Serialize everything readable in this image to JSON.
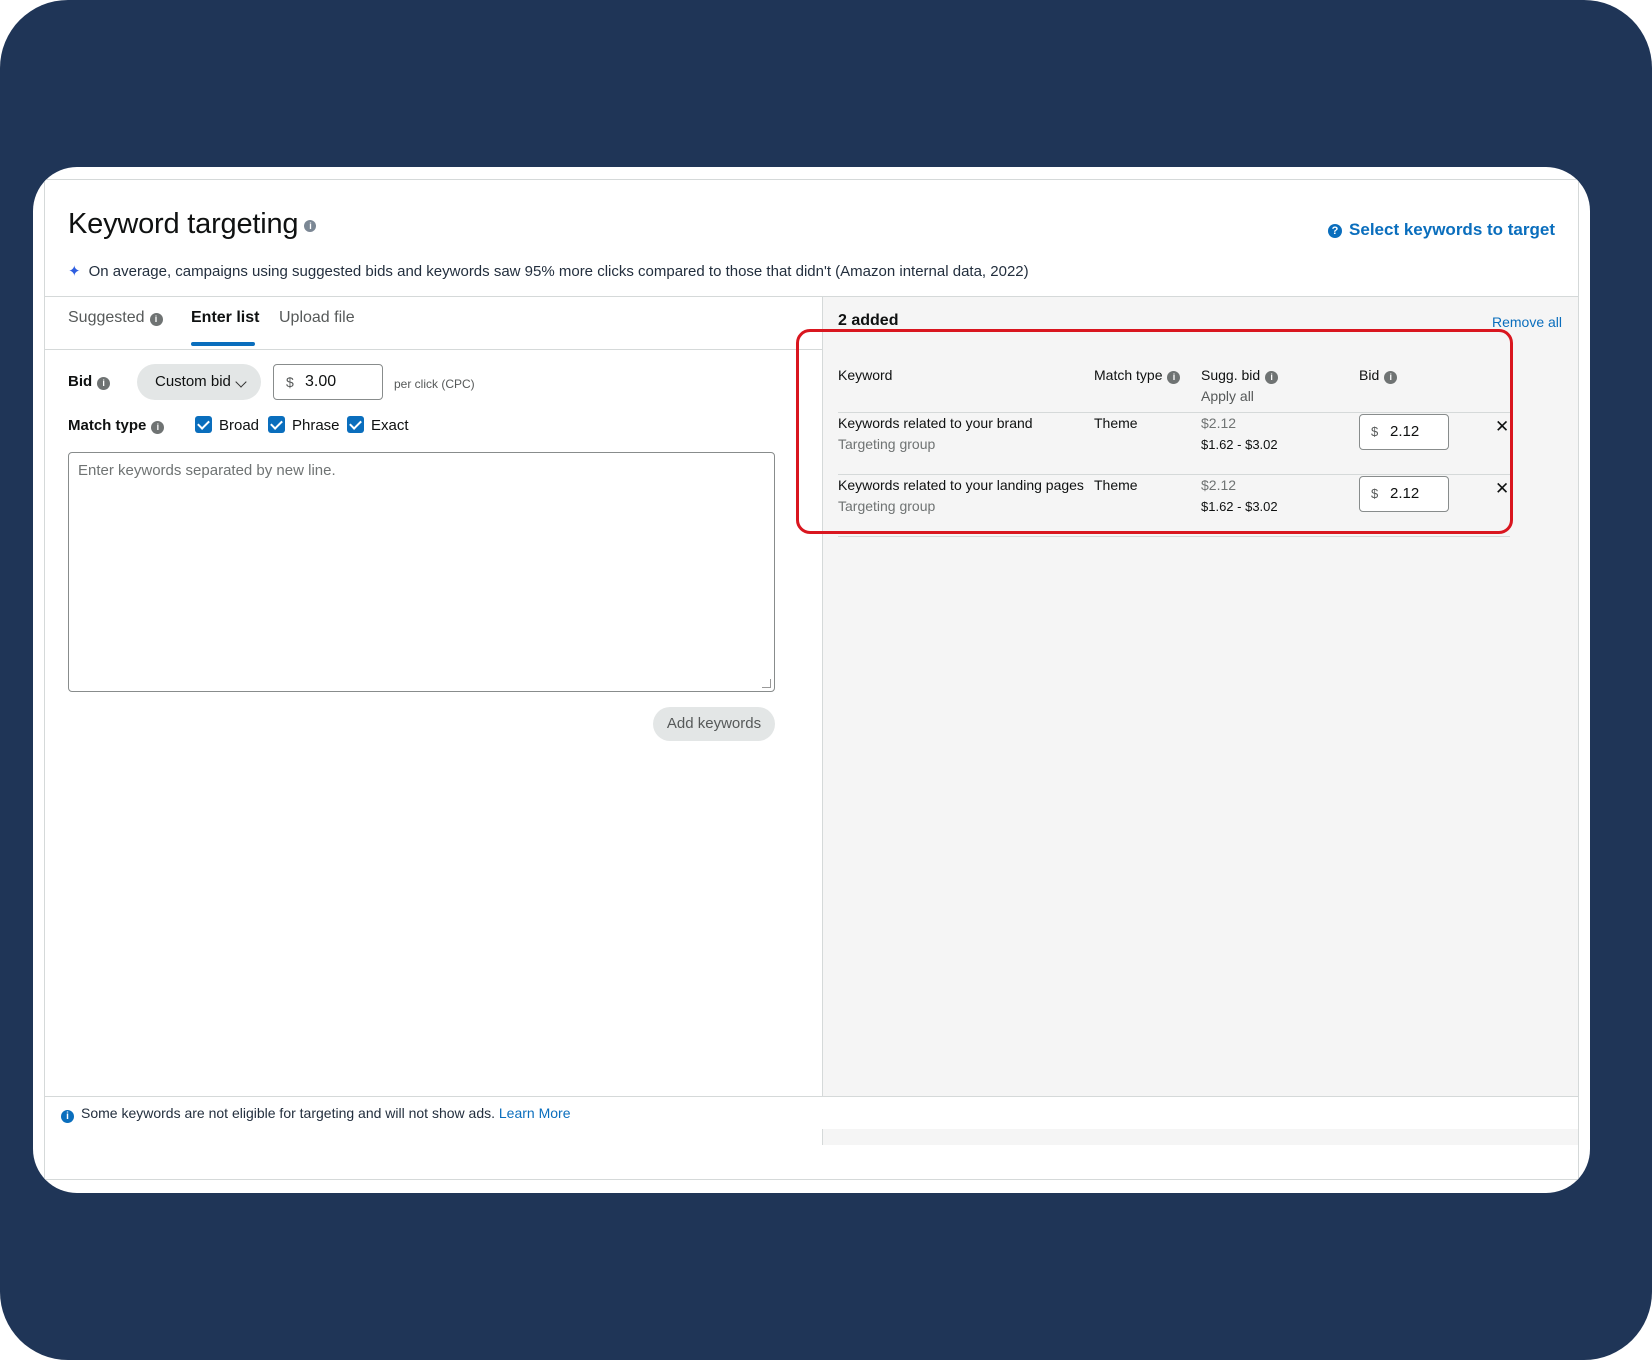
{
  "header": {
    "title": "Keyword targeting",
    "subtitle": "On average, campaigns using suggested bids and keywords saw 95% more clicks compared to those that didn't (Amazon internal data, 2022)",
    "select_link": "Select keywords to target"
  },
  "tabs": [
    {
      "label": "Suggested"
    },
    {
      "label": "Enter list"
    },
    {
      "label": "Upload file"
    }
  ],
  "form": {
    "bid_label": "Bid",
    "bid_type": "Custom bid",
    "currency": "$",
    "bid_value": "3.00",
    "per_click": "per click (CPC)",
    "match_type_label": "Match type",
    "match_types": [
      "Broad",
      "Phrase",
      "Exact"
    ],
    "textarea_placeholder": "Enter keywords separated by new line.",
    "add_button": "Add keywords"
  },
  "added": {
    "count_label": "2 added",
    "remove_all": "Remove all",
    "columns": {
      "keyword": "Keyword",
      "match_type": "Match type",
      "sugg_bid": "Sugg. bid",
      "apply_all": "Apply all",
      "bid": "Bid"
    },
    "rows": [
      {
        "keyword": "Keywords related to your brand",
        "sub": "Targeting group",
        "match_type": "Theme",
        "sugg_bid": "$2.12",
        "range": "$1.62 - $3.02",
        "currency": "$",
        "bid": "2.12"
      },
      {
        "keyword": "Keywords related to your landing pages",
        "sub": "Targeting group",
        "match_type": "Theme",
        "sugg_bid": "$2.12",
        "range": "$1.62 - $3.02",
        "currency": "$",
        "bid": "2.12"
      }
    ]
  },
  "footer": {
    "text": "Some keywords are not eligible for targeting and will not show ads.",
    "link": "Learn More"
  },
  "colors": {
    "background": "#1f3557",
    "accent": "#0a6ebd",
    "highlight": "#d9161f"
  }
}
